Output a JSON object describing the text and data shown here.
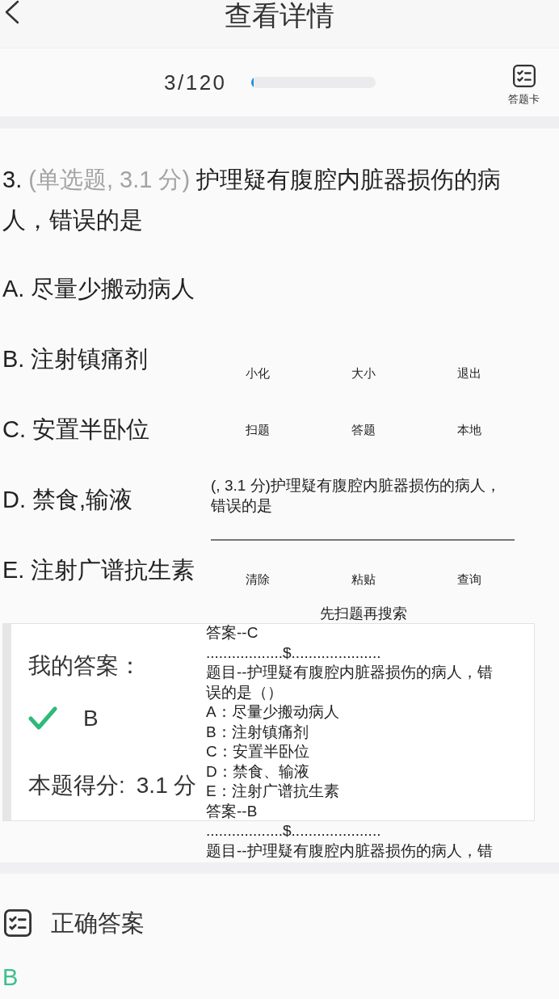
{
  "header": {
    "title": "查看详情"
  },
  "progress": {
    "counter": "3/120",
    "level": 0.025,
    "answer_card_label": "答题卡"
  },
  "question": {
    "number": "3.",
    "meta": "(单选题, 3.1 分)",
    "text": "护理疑有腹腔内脏器损伤的病人，错误的是",
    "options": [
      "A. 尽量少搬动病人",
      "B. 注射镇痛剂",
      "C. 安置半卧位",
      "D. 禁食,输液",
      "E. 注射广谱抗生素"
    ]
  },
  "my_answer": {
    "label": "我的答案：",
    "correct": true,
    "answer": "B",
    "score_label": "本题得分:",
    "score": "3.1 分"
  },
  "correct_answer": {
    "title": "正确答案",
    "answer": "B"
  },
  "floating_window": {
    "button_rows": [
      [
        "小化",
        "大小",
        "退出"
      ],
      [
        "扫题",
        "答题",
        "本地"
      ]
    ],
    "search_value": "(, 3.1 分)护理疑有腹腔内脏器损伤的病人，错误的是",
    "bottom_buttons": [
      "清除",
      "粘贴",
      "查询"
    ],
    "hint": "先扫题再搜索",
    "results": [
      "答案--C",
      "..................$.....................",
      "题目--护理疑有腹腔内脏器损伤的病人，错误的是（）",
      "A：尽量少搬动病人",
      "B：注射镇痛剂",
      "C：安置半卧位",
      "D：禁食、输液",
      "E：注射广谱抗生素",
      "答案--B",
      "..................$.....................",
      "题目--护理疑有腹腔内脏器损伤的病人，错"
    ]
  }
}
